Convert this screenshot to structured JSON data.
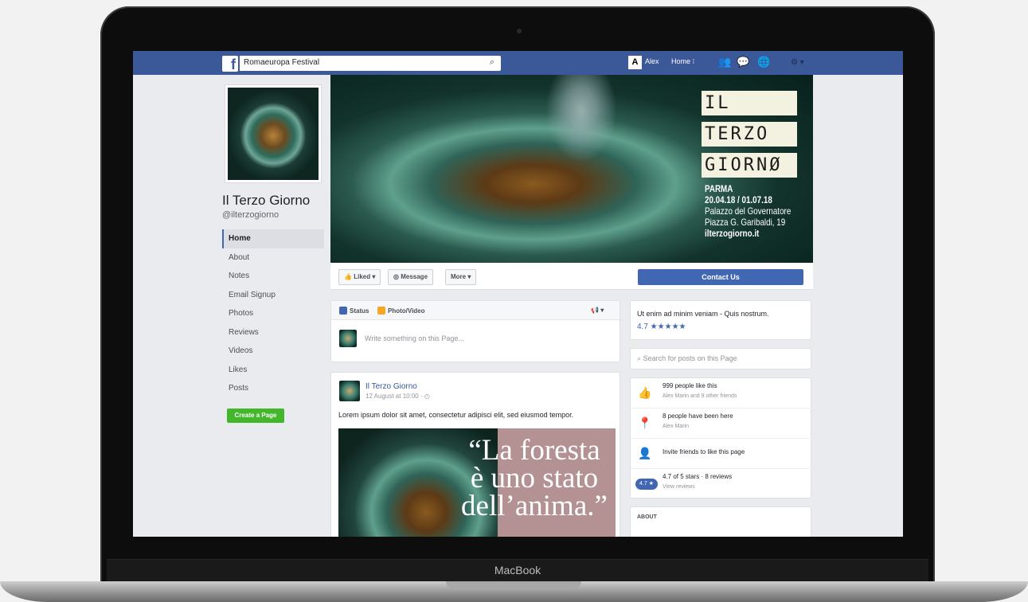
{
  "device": {
    "label": "MacBook"
  },
  "topbar": {
    "search_value": "Romaeuropa Festival",
    "user_name": "Alex",
    "home_label": "Home",
    "icons": [
      "friend-requests-icon",
      "messages-icon",
      "notifications-icon",
      "settings-icon"
    ]
  },
  "profile": {
    "name": "Il Terzo Giorno",
    "handle": "@ilterzogiorno"
  },
  "nav": {
    "items": [
      "Home",
      "About",
      "Notes",
      "Email Signup",
      "Photos",
      "Reviews",
      "Videos",
      "Likes",
      "Posts"
    ],
    "active": "Home",
    "create_page": "Create a Page"
  },
  "cover": {
    "title_lines": [
      "IL",
      "TERZO",
      "GIORNØ"
    ],
    "city": "PARMA",
    "dates": "20.04.18 / 01.07.18",
    "venue": "Palazzo del Governatore",
    "address": "Piazza G. Garibaldi, 19",
    "website": "ilterzogiorno.it"
  },
  "actions": {
    "liked": "Liked ▾",
    "message": "Message",
    "more": "More ▾",
    "contact": "Contact Us"
  },
  "composer": {
    "tab_status": "Status",
    "tab_photo": "Photo/Video",
    "placeholder": "Write something on this Page..."
  },
  "post": {
    "author": "Il Terzo Giorno",
    "time": "12 August at 10:00 · ◴",
    "text": "Lorem ipsum dolor sit amet, consectetur adipisci elit, sed eiusmod tempor.",
    "quote_lines": [
      "“La foresta",
      "è uno stato",
      "dell’anima.”"
    ]
  },
  "sidebar": {
    "rating_title": "Ut enim ad minim veniam - Quis nostrum.",
    "rating_value": "4.7 ★★★★★",
    "search_placeholder": "Search for posts on this Page",
    "stats": [
      {
        "main": "999 people like this",
        "sub": "Alex Marin and 9 other friends"
      },
      {
        "main": "8 people have been here",
        "sub": "Alex Marin"
      },
      {
        "main": "Invite friends to like this page",
        "sub": ""
      },
      {
        "main": "4.7 of 5 stars · 8 reviews",
        "sub": "View reviews"
      }
    ],
    "rating_badge": "4.7 ★",
    "about_label": "ABOUT"
  },
  "colors": {
    "fb_blue": "#3b5998",
    "button_blue": "#4267b2",
    "create_green": "#42b72a"
  }
}
